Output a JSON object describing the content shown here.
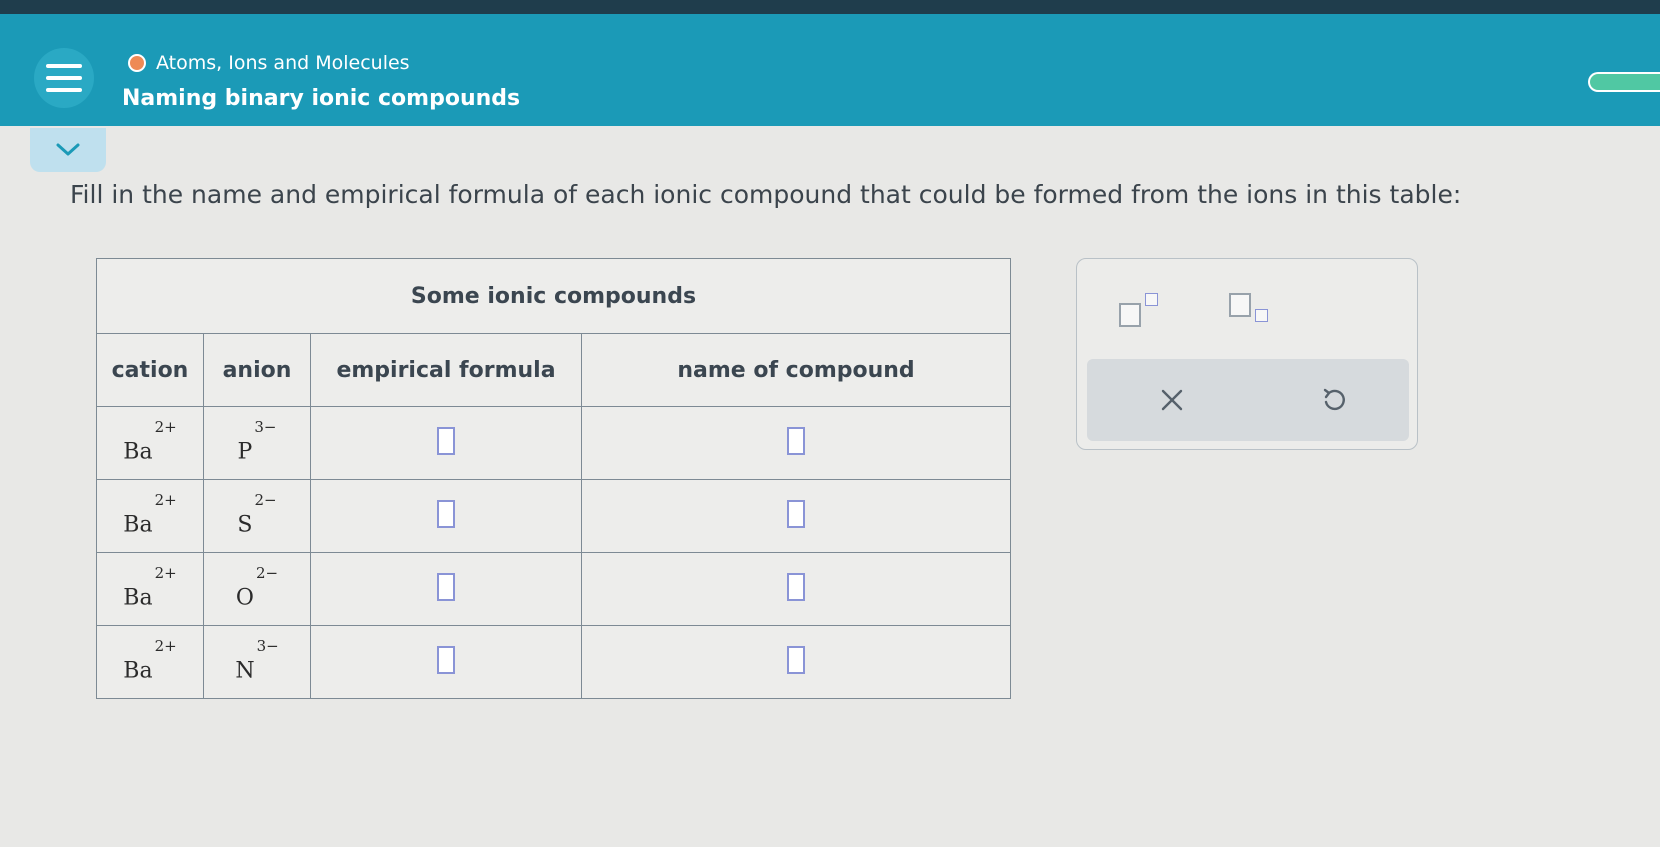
{
  "header": {
    "breadcrumb": "Atoms, Ions and Molecules",
    "title": "Naming binary ionic compounds",
    "accent_color": "#1b9ab7",
    "topic_dot_color": "#ee8a55"
  },
  "icons": {
    "menu": "hamburger-menu-icon",
    "collapse": "chevron-down-icon",
    "superscript": "superscript-icon",
    "subscript": "subscript-icon",
    "clear": "close-icon",
    "undo": "undo-icon"
  },
  "question": {
    "instruction": "Fill in the name and empirical formula of each ionic compound that could be formed from the ions in this table:"
  },
  "table": {
    "caption": "Some ionic compounds",
    "headers": {
      "cation": "cation",
      "anion": "anion",
      "formula": "empirical formula",
      "name": "name of compound"
    },
    "rows": [
      {
        "cation": "Ba",
        "cation_charge": "2+",
        "anion": "P",
        "anion_charge": "3−",
        "formula": "",
        "name": ""
      },
      {
        "cation": "Ba",
        "cation_charge": "2+",
        "anion": "S",
        "anion_charge": "2−",
        "formula": "",
        "name": ""
      },
      {
        "cation": "Ba",
        "cation_charge": "2+",
        "anion": "O",
        "anion_charge": "2−",
        "formula": "",
        "name": ""
      },
      {
        "cation": "Ba",
        "cation_charge": "2+",
        "anion": "N",
        "anion_charge": "3−",
        "formula": "",
        "name": ""
      }
    ]
  }
}
